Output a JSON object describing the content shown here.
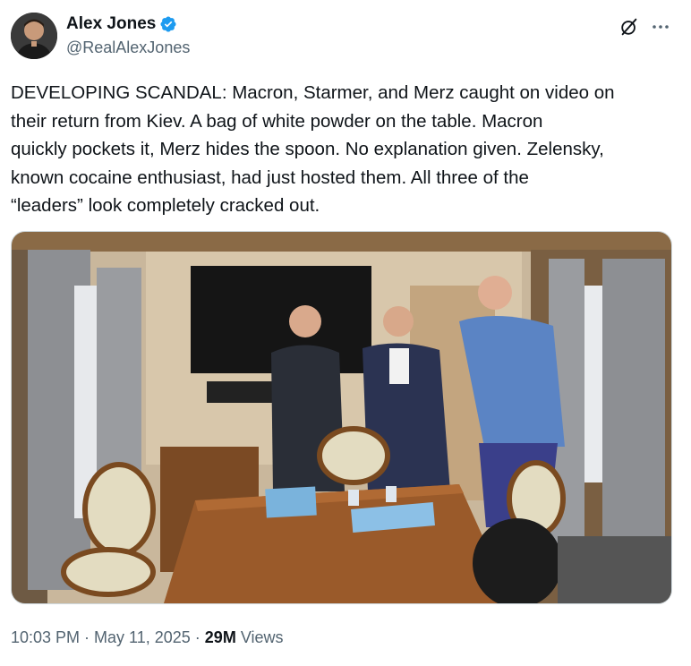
{
  "author": {
    "display_name": "Alex Jones",
    "handle": "@RealAlexJones",
    "verified": true,
    "verified_color": "#1d9bf0"
  },
  "tweet": {
    "text": "DEVELOPING SCANDAL: Macron, Starmer, and Merz caught on video on\ntheir return from Kiev. A bag of white powder on the table. Macron\nquickly pockets it, Merz hides the spoon. No explanation given. Zelensky,\nknown cocaine enthusiast, had just hosted them. All three of the\n“leaders” look completely cracked out."
  },
  "meta": {
    "time": "10:03 PM",
    "separator": "·",
    "date": "May 11, 2025",
    "views_count": "29M",
    "views_label": "Views"
  },
  "icons": {
    "grok": "grok-icon",
    "more": "more-icon",
    "verified": "verified-badge-icon"
  },
  "colors": {
    "text_primary": "#0f1419",
    "text_secondary": "#536471",
    "border": "#cfd9de"
  }
}
